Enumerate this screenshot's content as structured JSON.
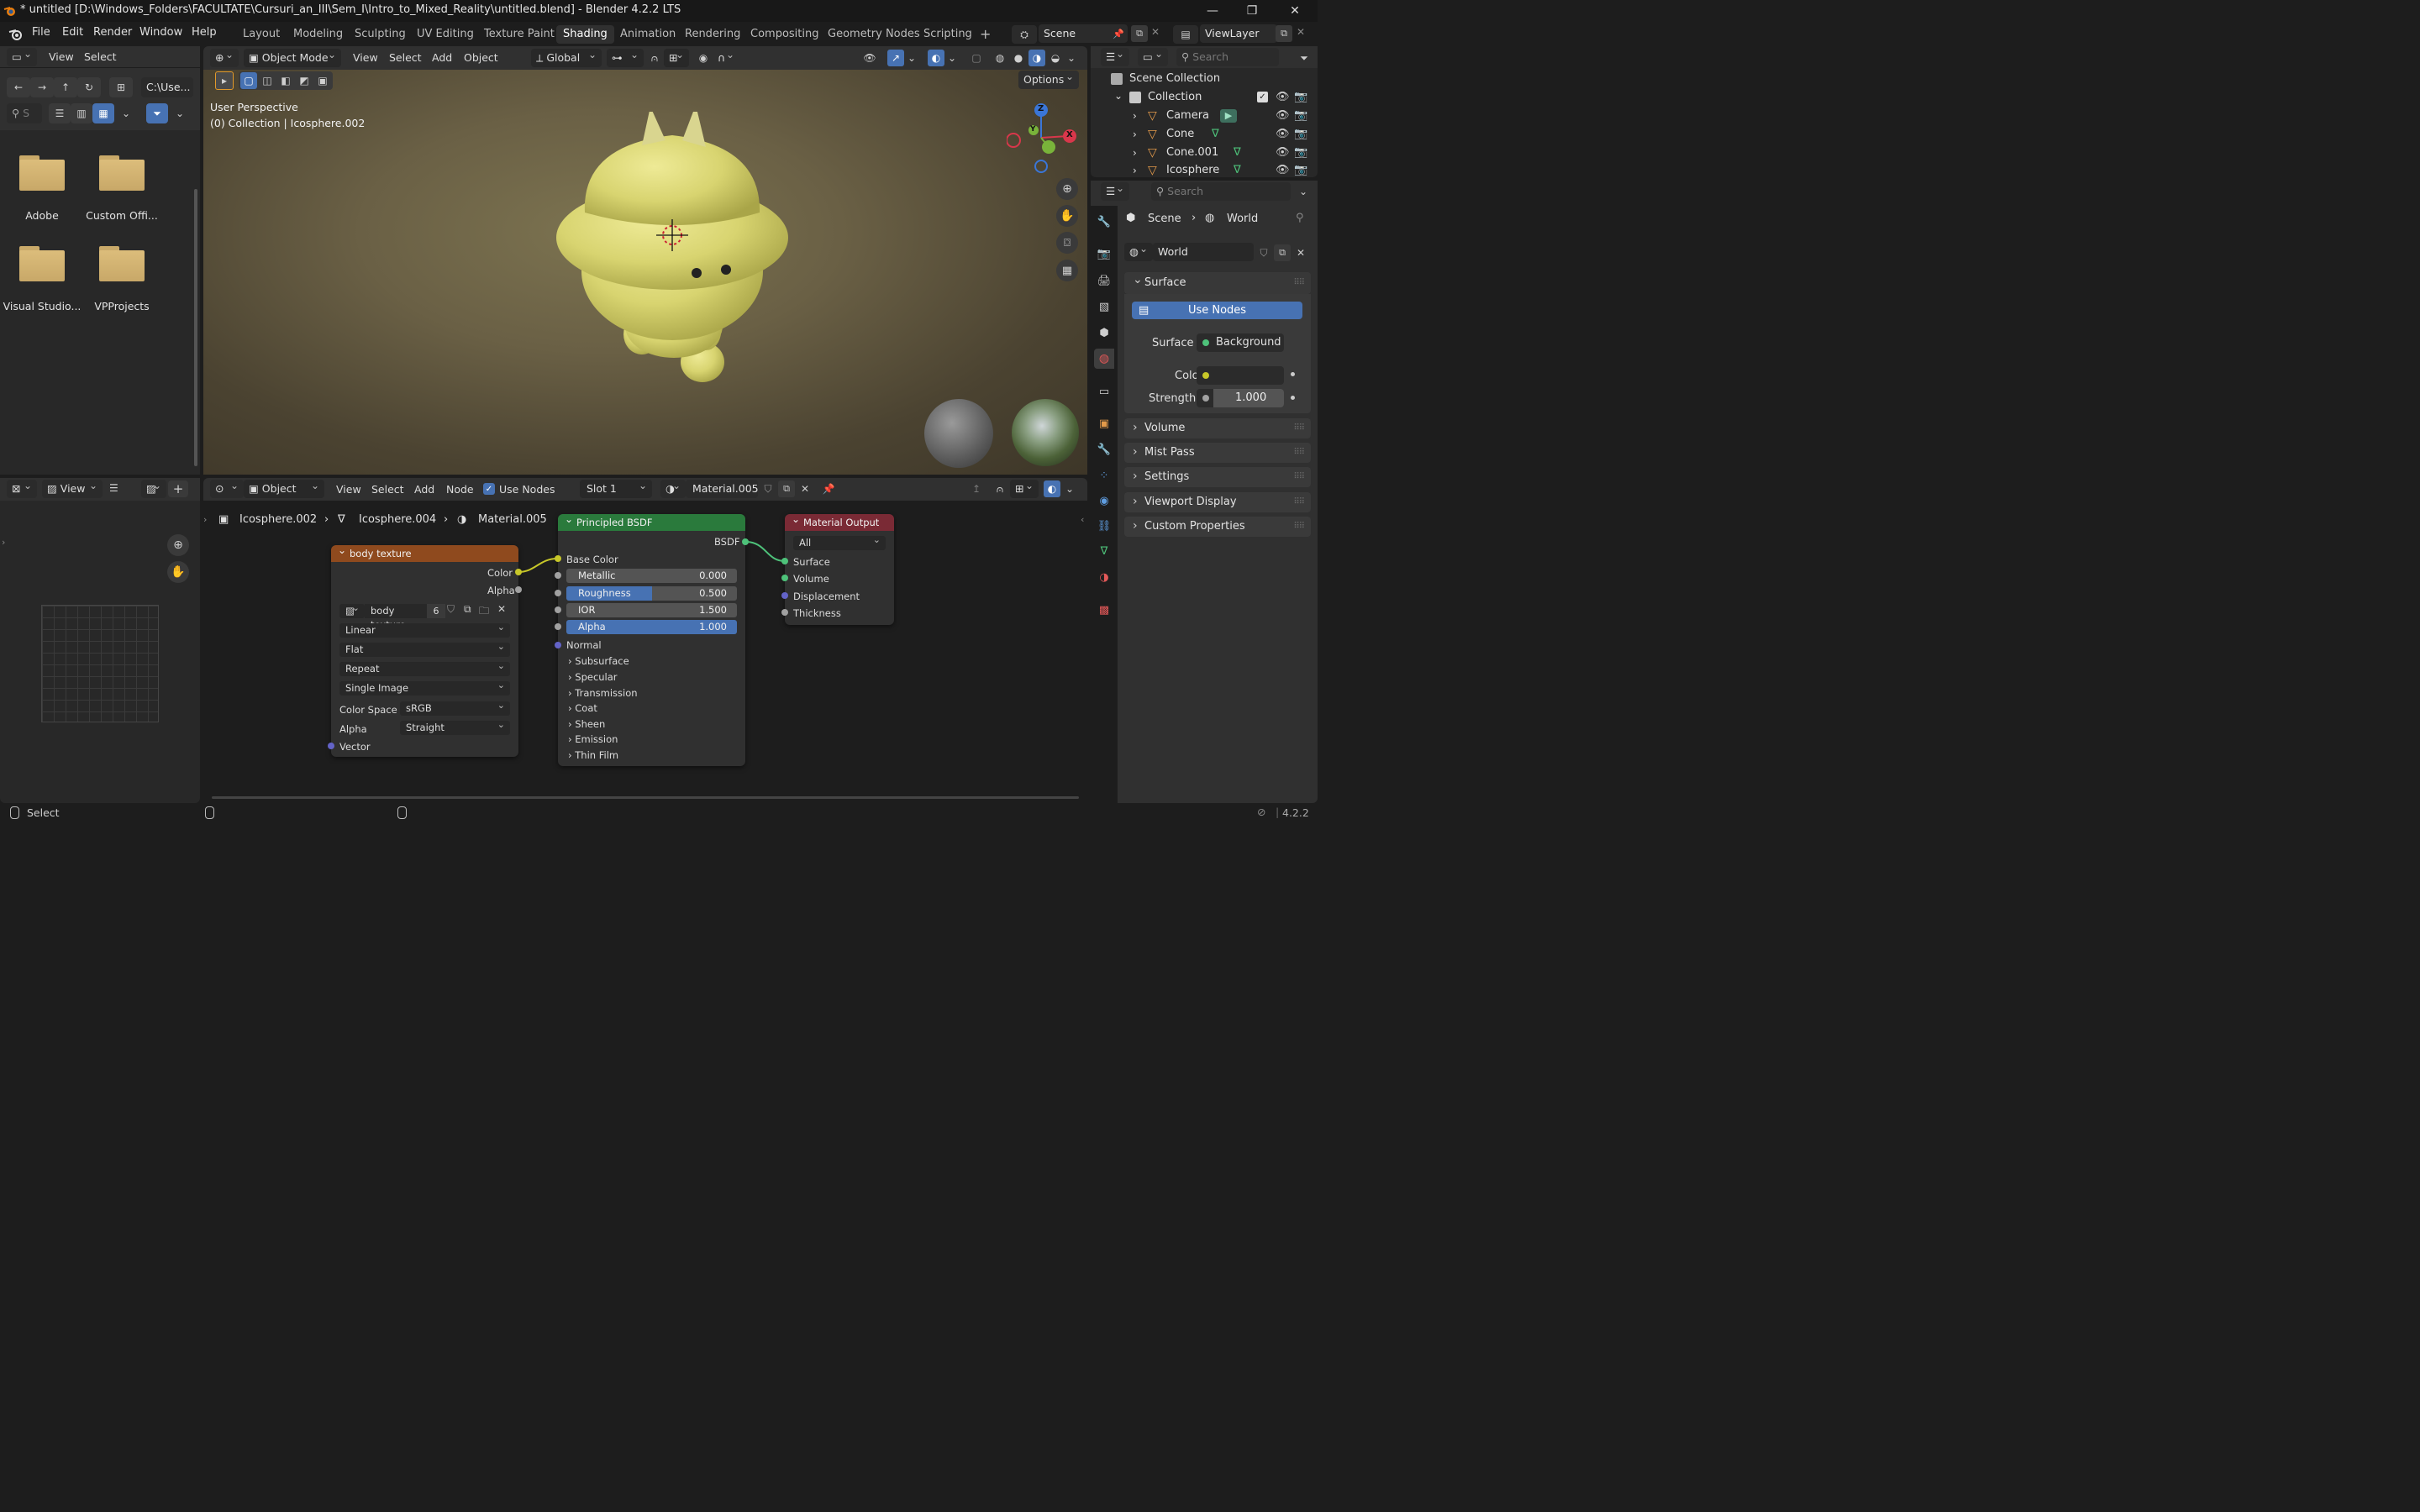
{
  "titlebar": {
    "title": "* untitled [D:\\Windows_Folders\\FACULTATE\\Cursuri_an_III\\Sem_I\\Intro_to_Mixed_Reality\\untitled.blend] - Blender 4.2.2 LTS",
    "minimize": "—",
    "maximize": "❐",
    "close": "✕"
  },
  "menubar": {
    "items": [
      "File",
      "Edit",
      "Render",
      "Window",
      "Help"
    ],
    "workspaces": [
      "Layout",
      "Modeling",
      "Sculpting",
      "UV Editing",
      "Texture Paint",
      "Shading",
      "Animation",
      "Rendering",
      "Compositing",
      "Geometry Nodes",
      "Scripting"
    ],
    "active_workspace": "Shading",
    "add_workspace": "+",
    "scene": "Scene",
    "view_layer": "ViewLayer"
  },
  "filebrowser": {
    "menu": [
      "View",
      "Select"
    ],
    "path": "C:\\Use...",
    "search_placeholder": "S",
    "folders": [
      "Adobe",
      "Custom Offi...",
      "Visual Studio...",
      "VPProjects"
    ]
  },
  "viewport": {
    "mode": "Object Mode",
    "menu": [
      "View",
      "Select",
      "Add",
      "Object"
    ],
    "orientation": "Global",
    "options": "Options",
    "perspective": "User Perspective",
    "collection_info": "(0) Collection | Icosphere.002",
    "gizmo": {
      "z": "Z",
      "y": "Y",
      "x": "X"
    },
    "model_color": "#e2de78"
  },
  "outliner": {
    "search_placeholder": "Search",
    "scene_collection": "Scene Collection",
    "collection": "Collection",
    "items": [
      "Camera",
      "Cone",
      "Cone.001",
      "Icosphere"
    ]
  },
  "properties": {
    "search_placeholder": "Search",
    "breadcrumb": [
      "Scene",
      "World"
    ],
    "world_name": "World",
    "sections": {
      "surface": "Surface",
      "volume": "Volume",
      "mist_pass": "Mist Pass",
      "settings": "Settings",
      "viewport_display": "Viewport Display",
      "custom_properties": "Custom Properties"
    },
    "use_nodes": "Use Nodes",
    "surface_label": "Surface",
    "surface_value": "Background",
    "color_label": "Color",
    "strength_label": "Strength",
    "strength_value": "1.000"
  },
  "imageeditor": {
    "view": "View"
  },
  "nodeeditor": {
    "object_mode": "Object",
    "menu": [
      "View",
      "Select",
      "Add",
      "Node"
    ],
    "use_nodes": "Use Nodes",
    "slot": "Slot 1",
    "material": "Material.005",
    "breadcrumb": [
      "Icosphere.002",
      "Icosphere.004",
      "Material.005"
    ],
    "image_node": {
      "title": "body texture",
      "out_color": "Color",
      "out_alpha": "Alpha",
      "image_name": "body texture",
      "users": "6",
      "interpolation": "Linear",
      "projection": "Flat",
      "extension": "Repeat",
      "source": "Single Image",
      "color_space_label": "Color Space",
      "color_space": "sRGB",
      "alpha_label": "Alpha",
      "alpha_mode": "Straight",
      "vector": "Vector"
    },
    "bsdf_node": {
      "title": "Principled BSDF",
      "out": "BSDF",
      "base_color": "Base Color",
      "metallic_label": "Metallic",
      "metallic": "0.000",
      "roughness_label": "Roughness",
      "roughness": "0.500",
      "roughness_fraction": 0.5,
      "ior_label": "IOR",
      "ior": "1.500",
      "alpha_label": "Alpha",
      "alpha": "1.000",
      "normal": "Normal",
      "panels": [
        "Subsurface",
        "Specular",
        "Transmission",
        "Coat",
        "Sheen",
        "Emission",
        "Thin Film"
      ]
    },
    "output_node": {
      "title": "Material Output",
      "target": "All",
      "inputs": [
        "Surface",
        "Volume",
        "Displacement",
        "Thickness"
      ]
    }
  },
  "statusbar": {
    "select": "Select",
    "version": "4.2.2"
  }
}
